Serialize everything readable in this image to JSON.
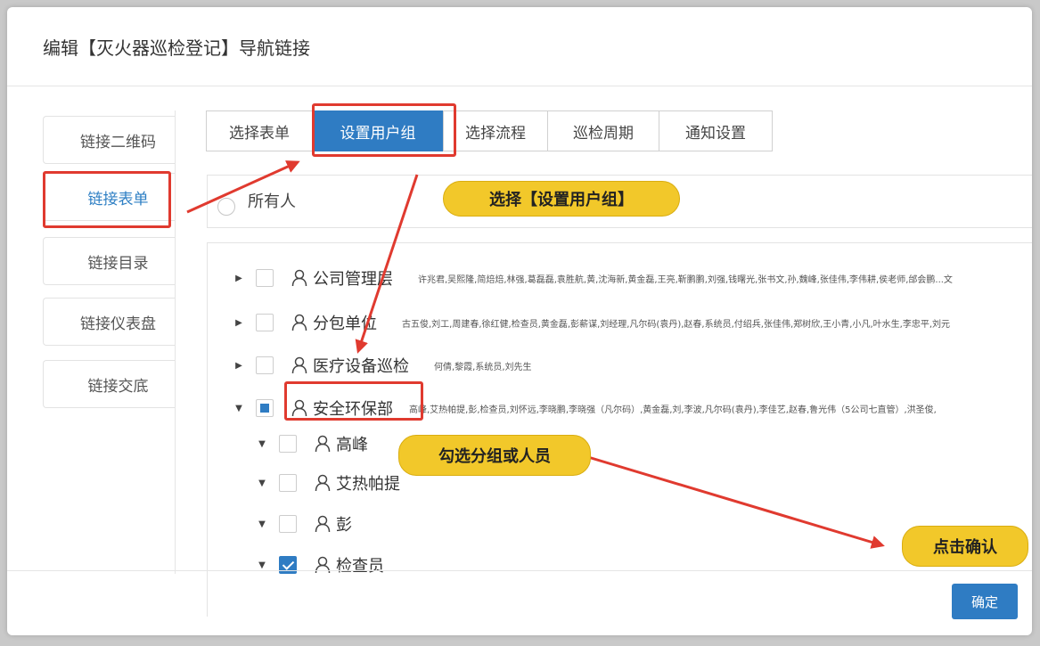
{
  "dialog": {
    "title": "编辑【灭火器巡检登记】导航链接"
  },
  "sidebar": {
    "items": [
      {
        "label": "链接二维码",
        "active": false
      },
      {
        "label": "链接表单",
        "active": true
      },
      {
        "label": "链接目录",
        "active": false
      },
      {
        "label": "链接仪表盘",
        "active": false
      },
      {
        "label": "链接交底",
        "active": false
      }
    ]
  },
  "tabs": [
    {
      "label": "选择表单",
      "active": false
    },
    {
      "label": "设置用户组",
      "active": true
    },
    {
      "label": "选择流程",
      "active": false
    },
    {
      "label": "巡检周期",
      "active": false
    },
    {
      "label": "通知设置",
      "active": false
    }
  ],
  "owner_option": {
    "label": "所有人"
  },
  "tree": [
    {
      "name": "公司管理层",
      "members": "许兆君,吴熙隆,简焙焙,林强,葛磊磊,袁胜航,黄,沈海新,黄金磊,王亮,靳鹏鹏,刘强,钱曙光,张书文,孙,魏峰,张佳伟,李伟耕,侯老师,邰会鹏...文",
      "expanded": false,
      "check": "none"
    },
    {
      "name": "分包单位",
      "members": "古五俊,刘工,周建春,徐红健,检查员,黄金磊,彭薪谋,刘经理,凡尔码(袁丹),赵春,系统员,付绍兵,张佳伟,郑树欣,王小青,小凡,叶水生,李忠平,刘元",
      "expanded": false,
      "check": "none"
    },
    {
      "name": "医疗设备巡检",
      "members": "何倩,黎霞,系统员,刘先生",
      "expanded": false,
      "check": "none"
    },
    {
      "name": "安全环保部",
      "members": "高峰,艾热帕提,彭,检查员,刘怀远,李晓鹏,李晓强（凡尔码）,黄金磊,刘,李波,凡尔码(袁丹),李佳艺,赵春,鲁光伟（5公司七直管）,洪圣俊,",
      "expanded": true,
      "check": "partial"
    },
    {
      "name": "高峰",
      "members": "",
      "expanded": true,
      "check": "none"
    },
    {
      "name": "艾热帕提",
      "members": "",
      "expanded": true,
      "check": "none"
    },
    {
      "name": "彭",
      "members": "",
      "expanded": true,
      "check": "none"
    },
    {
      "name": "检查员",
      "members": "",
      "expanded": true,
      "check": "checked"
    }
  ],
  "footer": {
    "confirm_label": "确定"
  },
  "annotations": {
    "callout_tab": "选择【设置用户组】",
    "callout_select": "勾选分组或人员",
    "callout_confirm": "点击确认"
  },
  "colors": {
    "primary": "#2f7cc3",
    "highlight_red": "#e03a2f",
    "callout_yellow": "#f2c82a"
  }
}
